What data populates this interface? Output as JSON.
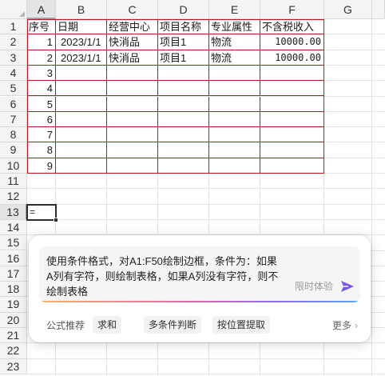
{
  "columns": [
    "A",
    "B",
    "C",
    "D",
    "E",
    "F",
    "G"
  ],
  "rows": [
    "1",
    "2",
    "3",
    "4",
    "5",
    "6",
    "7",
    "8",
    "9",
    "10",
    "11",
    "12",
    "13",
    "14",
    "15",
    "16",
    "17",
    "18",
    "19",
    "20",
    "21",
    "22",
    "23"
  ],
  "selected_column": "A",
  "selected_row": "13",
  "table": {
    "headers": [
      "序号",
      "日期",
      "经营中心",
      "项目名称",
      "专业属性",
      "不含税收入"
    ],
    "rows": [
      [
        "1",
        "2023/1/1",
        "快消品",
        "项目1",
        "物流",
        "10000.00"
      ],
      [
        "2",
        "2023/1/1",
        "快消品",
        "项目1",
        "物流",
        "10000.00"
      ],
      [
        "3",
        "",
        "",
        "",
        "",
        ""
      ],
      [
        "4",
        "",
        "",
        "",
        "",
        ""
      ],
      [
        "5",
        "",
        "",
        "",
        "",
        ""
      ],
      [
        "6",
        "",
        "",
        "",
        "",
        ""
      ],
      [
        "7",
        "",
        "",
        "",
        "",
        ""
      ],
      [
        "8",
        "",
        "",
        "",
        "",
        ""
      ],
      [
        "9",
        "",
        "",
        "",
        "",
        ""
      ]
    ]
  },
  "active_cell": {
    "content": "="
  },
  "ai_panel": {
    "prompt": "使用条件格式，对A1:F50绘制边框，条件为：如果A列有字符，则绘制表格，如果A列没有字符，则不绘制表格",
    "trial_label": "限时体验",
    "send_icon": "send-arrow-icon",
    "recommend_label": "公式推荐",
    "chips": [
      "求和",
      "多条件判断",
      "按位置提取"
    ],
    "more_label": "更多"
  },
  "colors": {
    "border_red": "#c0161e",
    "send_purple": "#7b55f0"
  }
}
